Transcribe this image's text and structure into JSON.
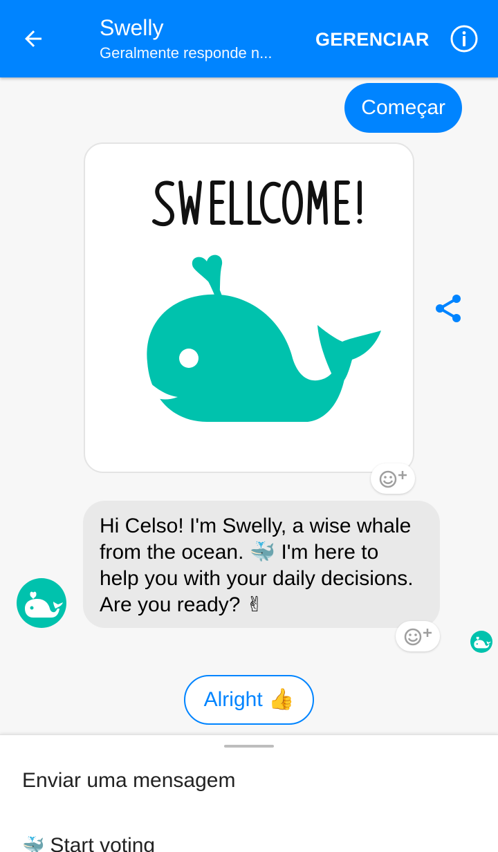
{
  "header": {
    "title": "Swelly",
    "subtitle": "Geralmente responde n...",
    "manage_label": "GERENCIAR",
    "background_color": "#0084ff"
  },
  "icons": {
    "back": "arrow-left-icon",
    "info": "info-icon",
    "share": "share-icon",
    "react": "add-reaction-icon",
    "avatar": "whale-icon"
  },
  "chat": {
    "outgoing_message": "Começar",
    "card_image_text": "SWELLCOME!",
    "incoming_message": "Hi Celso! I'm Swelly, a wise whale from the ocean. 🐳 I'm here to help you with your daily decisions. Are you ready? ✌",
    "quick_reply": "Alright 👍",
    "brand_color": "#00c2ad"
  },
  "sheet": {
    "items": [
      "Enviar uma mensagem",
      "Start voting"
    ],
    "start_voting_emoji": "🐳"
  }
}
